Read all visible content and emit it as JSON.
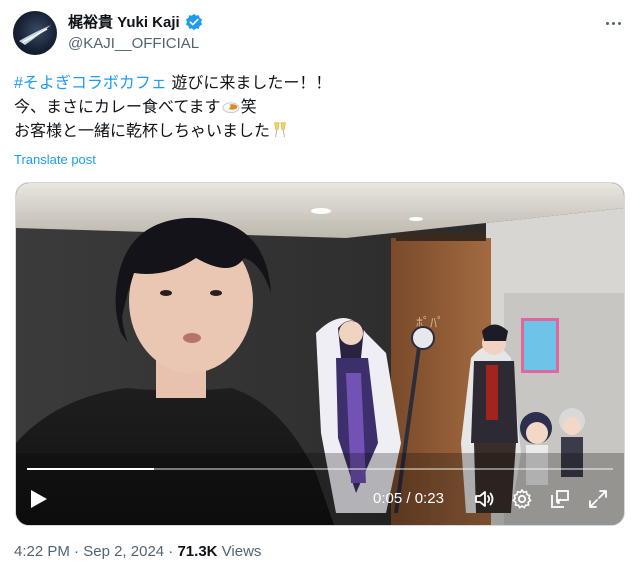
{
  "author": {
    "display_name": "梶裕貴 Yuki Kaji",
    "handle": "@KAJI__OFFICIAL"
  },
  "tweet": {
    "hashtag": "#そよぎコラボカフェ",
    "line1_rest": " 遊びに来ましたー！！",
    "line2_a": "今、まさにカレー食べてます",
    "line2_b": "笑",
    "line3": "お客様と一緒に乾杯しちゃいました",
    "translate_label": "Translate post"
  },
  "video": {
    "time_current": "0:05",
    "time_separator": " / ",
    "time_total": "0:23",
    "progress": 0.217
  },
  "meta": {
    "time": "4:22 PM",
    "dot1": " · ",
    "date": "Sep 2, 2024",
    "dot2": " · ",
    "views_count": "71.3K",
    "views_label": " Views"
  },
  "colors": {
    "accent": "#1d9bf0",
    "text_primary": "#0f1419",
    "text_secondary": "#536471"
  },
  "icons": [
    "verified-badge-icon",
    "more-icon",
    "curry-emoji-icon",
    "champagne-emoji-icon",
    "play-icon",
    "volume-icon",
    "settings-icon",
    "pip-icon",
    "fullscreen-icon"
  ]
}
